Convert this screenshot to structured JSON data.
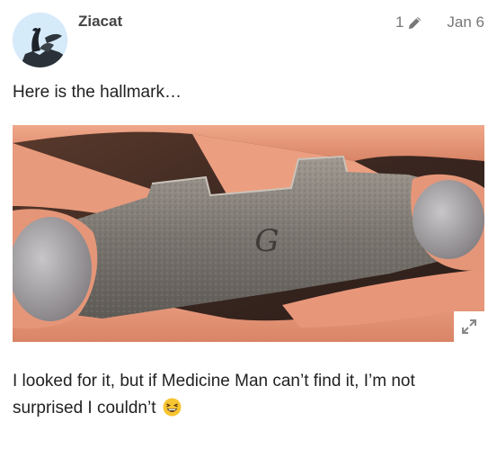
{
  "post": {
    "username": "Ziacat",
    "edit_count": "1",
    "date": "Jan 6",
    "paragraph_1": "Here is the hallmark…",
    "paragraph_2": "I looked for it, but if Medicine Man can’t find it, I’m not surprised I couldn’t",
    "emoji": "laughing-emoji",
    "image": {
      "subject": "metal piece with G hallmark held between fingers",
      "hallmark_letter": "G"
    }
  },
  "colors": {
    "text": "#222222",
    "muted": "#777777",
    "username": "#444444",
    "avatar_bg": "#cfe6f8"
  },
  "icons": [
    "pencil-icon",
    "expand-icon",
    "laughing-emoji"
  ]
}
